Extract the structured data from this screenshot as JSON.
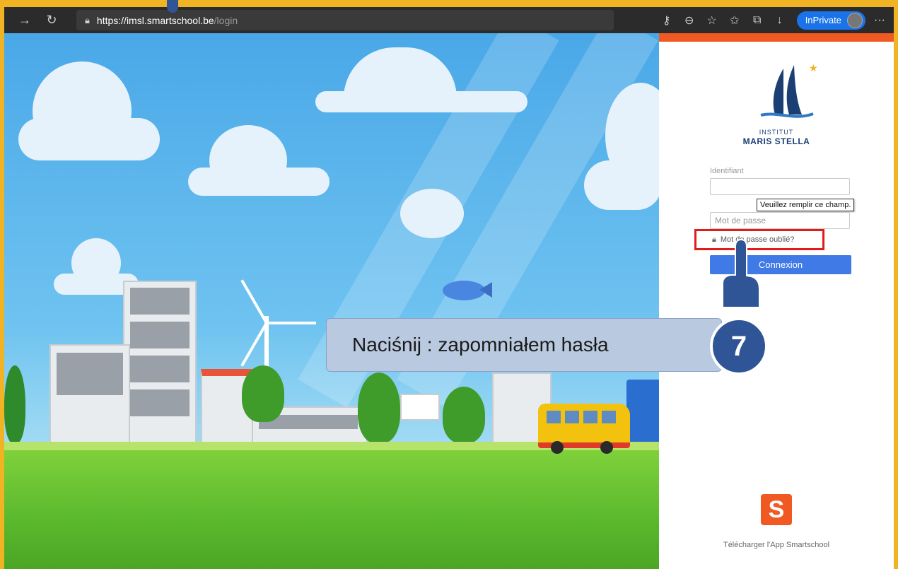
{
  "browser": {
    "url_host": "https://imsl.smartschool.be",
    "url_path": "/login",
    "inprivate_label": "InPrivate",
    "icons": [
      "forward-icon",
      "refresh-icon",
      "lock-icon",
      "key-icon",
      "zoom-icon",
      "favorite-add-icon",
      "favorites-icon",
      "collections-icon",
      "downloads-icon",
      "more-icon"
    ]
  },
  "logo": {
    "line1": "INSTITUT",
    "line2": "MARIS STELLA"
  },
  "login": {
    "id_label": "Identifiant",
    "id_value": "",
    "tooltip": "Veuillez remplir ce champ.",
    "password_placeholder": "Mot de passe",
    "forgot_label": "Mot de passe oublié?",
    "submit_label": "Connexion"
  },
  "app": {
    "icon_letter": "S",
    "download_label": "Télécharger l'App Smartschool"
  },
  "callout": {
    "text": "Naciśnij : zapomniałem hasła",
    "step_number": "7"
  },
  "colors": {
    "frame": "#f0b323",
    "accent_orange": "#f05a22",
    "button_blue": "#3f7ae6",
    "highlight_red": "#e21b1b",
    "step_blue": "#2f5597"
  }
}
